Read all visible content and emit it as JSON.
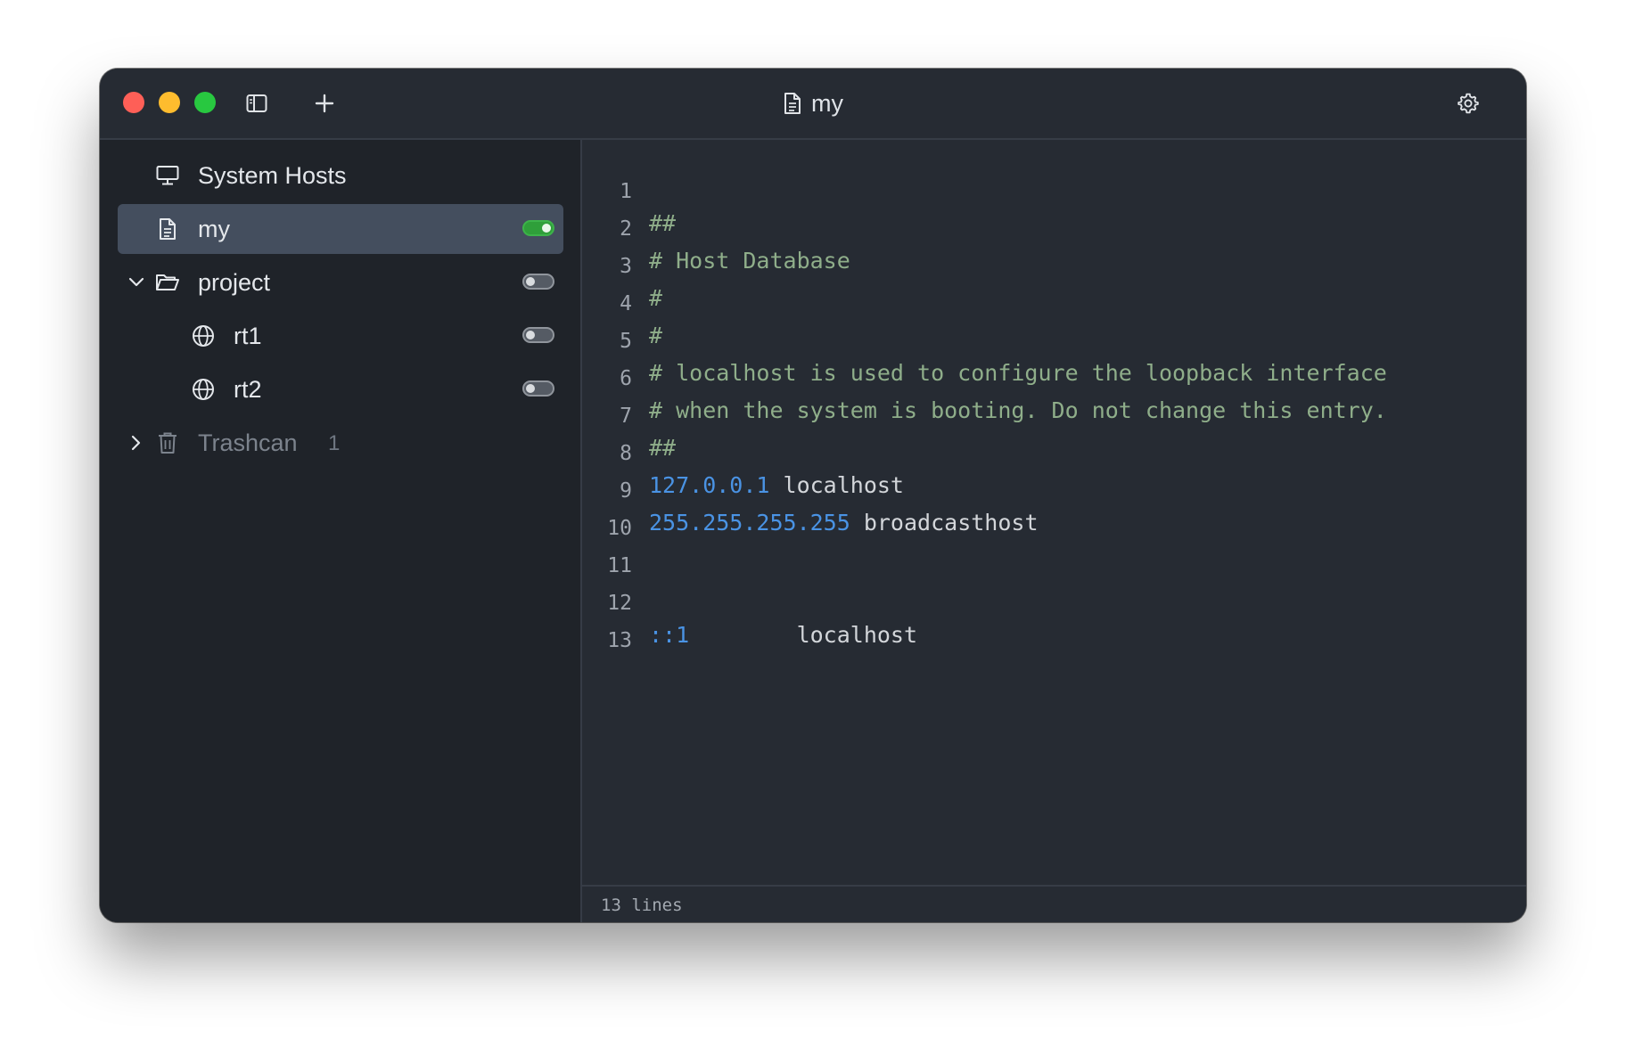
{
  "window": {
    "title": "my"
  },
  "sidebar": {
    "items": [
      {
        "label": "System Hosts",
        "icon": "monitor-icon"
      },
      {
        "label": "my",
        "icon": "file-icon",
        "enabled": true,
        "selected": true
      },
      {
        "label": "project",
        "icon": "folder-open-icon",
        "expanded": true,
        "enabled": false
      },
      {
        "label": "rt1",
        "icon": "globe-icon",
        "enabled": false
      },
      {
        "label": "rt2",
        "icon": "globe-icon",
        "enabled": false
      },
      {
        "label": "Trashcan",
        "icon": "trash-icon",
        "expanded": false,
        "count": "1"
      }
    ]
  },
  "editor": {
    "lines": [
      {
        "num": "1",
        "comment": "##"
      },
      {
        "num": "2",
        "comment": "# Host Database"
      },
      {
        "num": "3",
        "comment": "#"
      },
      {
        "num": "4",
        "comment": "#"
      },
      {
        "num": "5",
        "comment": "# localhost is used to configure the loopback interface"
      },
      {
        "num": "6",
        "comment": "# when the system is booting. Do not change this entry."
      },
      {
        "num": "7",
        "comment": "##"
      },
      {
        "num": "8",
        "ip": "127.0.0.1",
        "host": " localhost"
      },
      {
        "num": "9",
        "ip": "255.255.255.255",
        "host": " broadcasthost"
      },
      {
        "num": "10"
      },
      {
        "num": "11"
      },
      {
        "num": "12",
        "ip": "::1",
        "host": "        localhost"
      },
      {
        "num": "13"
      }
    ]
  },
  "statusbar": {
    "text": "13 lines"
  },
  "colors": {
    "comment": "#8fae8a",
    "ip": "#4a93e4",
    "toggle_on": "#2f9f3a",
    "selected_row": "#444e5e"
  }
}
